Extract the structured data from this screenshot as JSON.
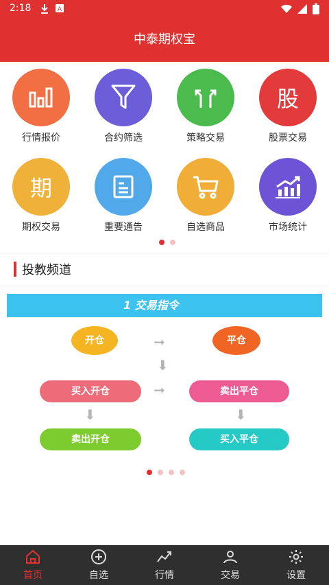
{
  "statusbar": {
    "time": "2:18"
  },
  "header": {
    "title": "中泰期权宝"
  },
  "grid": {
    "items": [
      {
        "label": "行情报价",
        "icon": "bar-chart-icon",
        "color": "#f26f43"
      },
      {
        "label": "合约筛选",
        "icon": "filter-icon",
        "color": "#6b5ed8"
      },
      {
        "label": "策略交易",
        "icon": "split-arrows-icon",
        "color": "#4bbb4e"
      },
      {
        "label": "股票交易",
        "icon": "stock-glyph-icon",
        "glyph": "股",
        "color": "#e33b3b"
      },
      {
        "label": "期权交易",
        "icon": "option-glyph-icon",
        "glyph": "期",
        "color": "#f0b13a"
      },
      {
        "label": "重要通告",
        "icon": "notice-icon",
        "color": "#51a9ea"
      },
      {
        "label": "自选商品",
        "icon": "cart-icon",
        "color": "#f0ad37"
      },
      {
        "label": "市场统计",
        "icon": "market-stats-icon",
        "color": "#6d53d5"
      }
    ]
  },
  "section": {
    "title": "投教频道"
  },
  "banner": {
    "heading": "1 交易指令",
    "nodes": {
      "open": "开仓",
      "close": "平仓",
      "buy_open": "买入开仓",
      "sell_close": "卖出平仓",
      "sell_open": "卖出开仓",
      "buy_close": "买入平仓"
    }
  },
  "tabs": [
    {
      "label": "首页",
      "icon": "home-icon",
      "active": true
    },
    {
      "label": "自选",
      "icon": "plus-circle-icon",
      "active": false
    },
    {
      "label": "行情",
      "icon": "trend-icon",
      "active": false
    },
    {
      "label": "交易",
      "icon": "user-icon",
      "active": false
    },
    {
      "label": "设置",
      "icon": "gear-icon",
      "active": false
    }
  ],
  "colors": {
    "brand": "#e03131",
    "tabbar": "#2f2f2f",
    "banner": "#3cc2ee"
  }
}
